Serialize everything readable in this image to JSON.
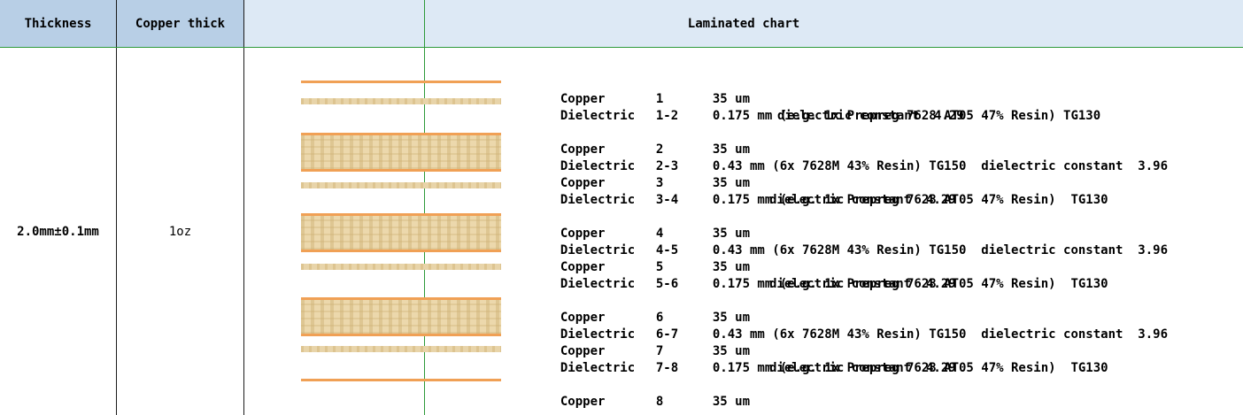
{
  "header": {
    "thickness": "Thickness",
    "copper_thick": "Copper thick",
    "laminated_chart": "Laminated chart"
  },
  "row": {
    "thickness": "2.0mm±0.1mm",
    "copper": "1oz"
  },
  "stackup": [
    {
      "type": "Copper",
      "num": "1",
      "desc": "35 um",
      "desc2": ""
    },
    {
      "type": "Dielectric",
      "num": "1-2",
      "desc": "0.175 mm (e.g. 1x Prepreg 7628 AT05 47% Resin) TG130",
      "desc2": "dielectric constant  4.29"
    },
    {
      "type": "Copper",
      "num": "2",
      "desc": "35 um",
      "desc2": ""
    },
    {
      "type": "Dielectric",
      "num": "2-3",
      "desc": "0.43 mm (6x 7628M 43% Resin) TG150  dielectric constant  3.96",
      "desc2": ""
    },
    {
      "type": "Copper",
      "num": "3",
      "desc": "35 um",
      "desc2": ""
    },
    {
      "type": "Dielectric",
      "num": "3-4",
      "desc": "0.175 mm (e.g. 1x Prepreg 7628 AT05 47% Resin)  TG130",
      "desc2": "dielectric constant  4.29"
    },
    {
      "type": "Copper",
      "num": "4",
      "desc": "35 um",
      "desc2": ""
    },
    {
      "type": "Dielectric",
      "num": "4-5",
      "desc": "0.43 mm (6x 7628M 43% Resin) TG150  dielectric constant  3.96",
      "desc2": ""
    },
    {
      "type": "Copper",
      "num": "5",
      "desc": "35 um",
      "desc2": ""
    },
    {
      "type": "Dielectric",
      "num": "5-6",
      "desc": "0.175 mm (e.g. 1x Prepreg 7628 AT05 47% Resin)  TG130",
      "desc2": "dielectric constant  4.29"
    },
    {
      "type": "Copper",
      "num": "6",
      "desc": "35 um",
      "desc2": ""
    },
    {
      "type": "Dielectric",
      "num": "6-7",
      "desc": "0.43 mm (6x 7628M 43% Resin) TG150  dielectric constant  3.96",
      "desc2": ""
    },
    {
      "type": "Copper",
      "num": "7",
      "desc": "35 um",
      "desc2": ""
    },
    {
      "type": "Dielectric",
      "num": "7-8",
      "desc": "0.175 mm (e.g. 1x Prepreg 7628 AT05 47% Resin)  TG130",
      "desc2": "dielectric constant  4.29"
    },
    {
      "type": "Copper",
      "num": "8",
      "desc": "35 um",
      "desc2": ""
    }
  ]
}
